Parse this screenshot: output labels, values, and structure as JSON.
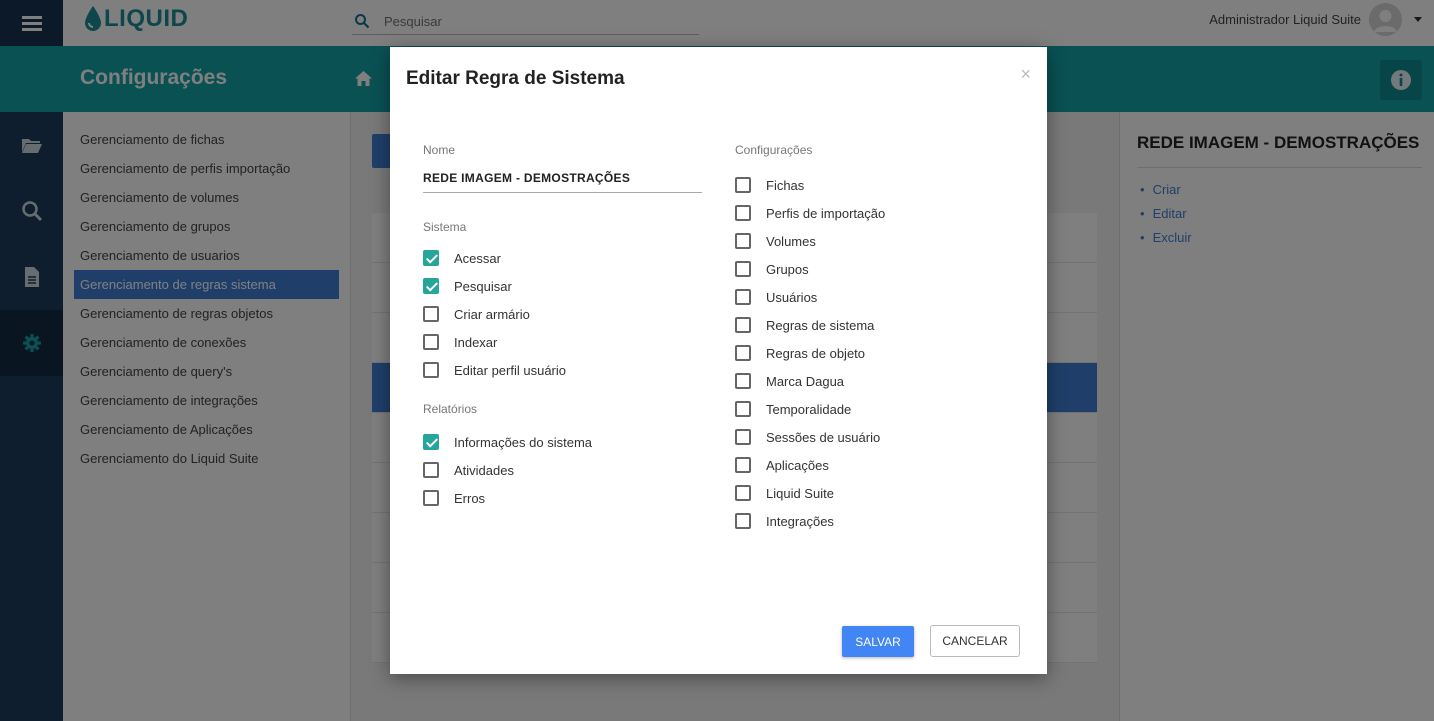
{
  "app": {
    "logo_text": "LIQUID"
  },
  "search": {
    "placeholder": "Pesquisar"
  },
  "user": {
    "name": "Administrador Liquid Suite"
  },
  "page": {
    "title": "Configurações"
  },
  "submenu": {
    "items": [
      "Gerenciamento de fichas",
      "Gerenciamento de perfis importação",
      "Gerenciamento de volumes",
      "Gerenciamento de grupos",
      "Gerenciamento de usuarios",
      "Gerenciamento de regras sistema",
      "Gerenciamento de regras objetos",
      "Gerenciamento de conexões",
      "Gerenciamento de query's",
      "Gerenciamento de integrações",
      "Gerenciamento de Aplicações",
      "Gerenciamento do Liquid Suite"
    ],
    "active_index": 5
  },
  "right_panel": {
    "title": "REDE IMAGEM - DEMOSTRAÇÕES",
    "actions": [
      "Criar",
      "Editar",
      "Excluir"
    ]
  },
  "modal": {
    "title": "Editar Regra de Sistema",
    "close": "×",
    "name_label": "Nome",
    "name_value": "REDE IMAGEM - DEMOSTRAÇÕES",
    "sistema": {
      "label": "Sistema",
      "items": [
        {
          "label": "Acessar",
          "checked": true
        },
        {
          "label": "Pesquisar",
          "checked": true
        },
        {
          "label": "Criar armário",
          "checked": false
        },
        {
          "label": "Indexar",
          "checked": false
        },
        {
          "label": "Editar perfil usuário",
          "checked": false
        }
      ]
    },
    "relatorios": {
      "label": "Relatórios",
      "items": [
        {
          "label": "Informações do sistema",
          "checked": true
        },
        {
          "label": "Atividades",
          "checked": false
        },
        {
          "label": "Erros",
          "checked": false
        }
      ]
    },
    "configuracoes": {
      "label": "Configurações",
      "items": [
        {
          "label": "Fichas",
          "checked": false
        },
        {
          "label": "Perfis de importação",
          "checked": false
        },
        {
          "label": "Volumes",
          "checked": false
        },
        {
          "label": "Grupos",
          "checked": false
        },
        {
          "label": "Usuários",
          "checked": false
        },
        {
          "label": "Regras de sistema",
          "checked": false
        },
        {
          "label": "Regras de objeto",
          "checked": false
        },
        {
          "label": "Marca Dagua",
          "checked": false
        },
        {
          "label": "Temporalidade",
          "checked": false
        },
        {
          "label": "Sessões de usuário",
          "checked": false
        },
        {
          "label": "Aplicações",
          "checked": false
        },
        {
          "label": "Liquid Suite",
          "checked": false
        },
        {
          "label": "Integrações",
          "checked": false
        }
      ]
    },
    "save_label": "SALVAR",
    "cancel_label": "CANCELAR"
  },
  "colors": {
    "teal": "#15a2a8",
    "navy": "#1d3d5c",
    "primary_blue": "#4285f4",
    "checkbox_checked": "#26a69a"
  }
}
